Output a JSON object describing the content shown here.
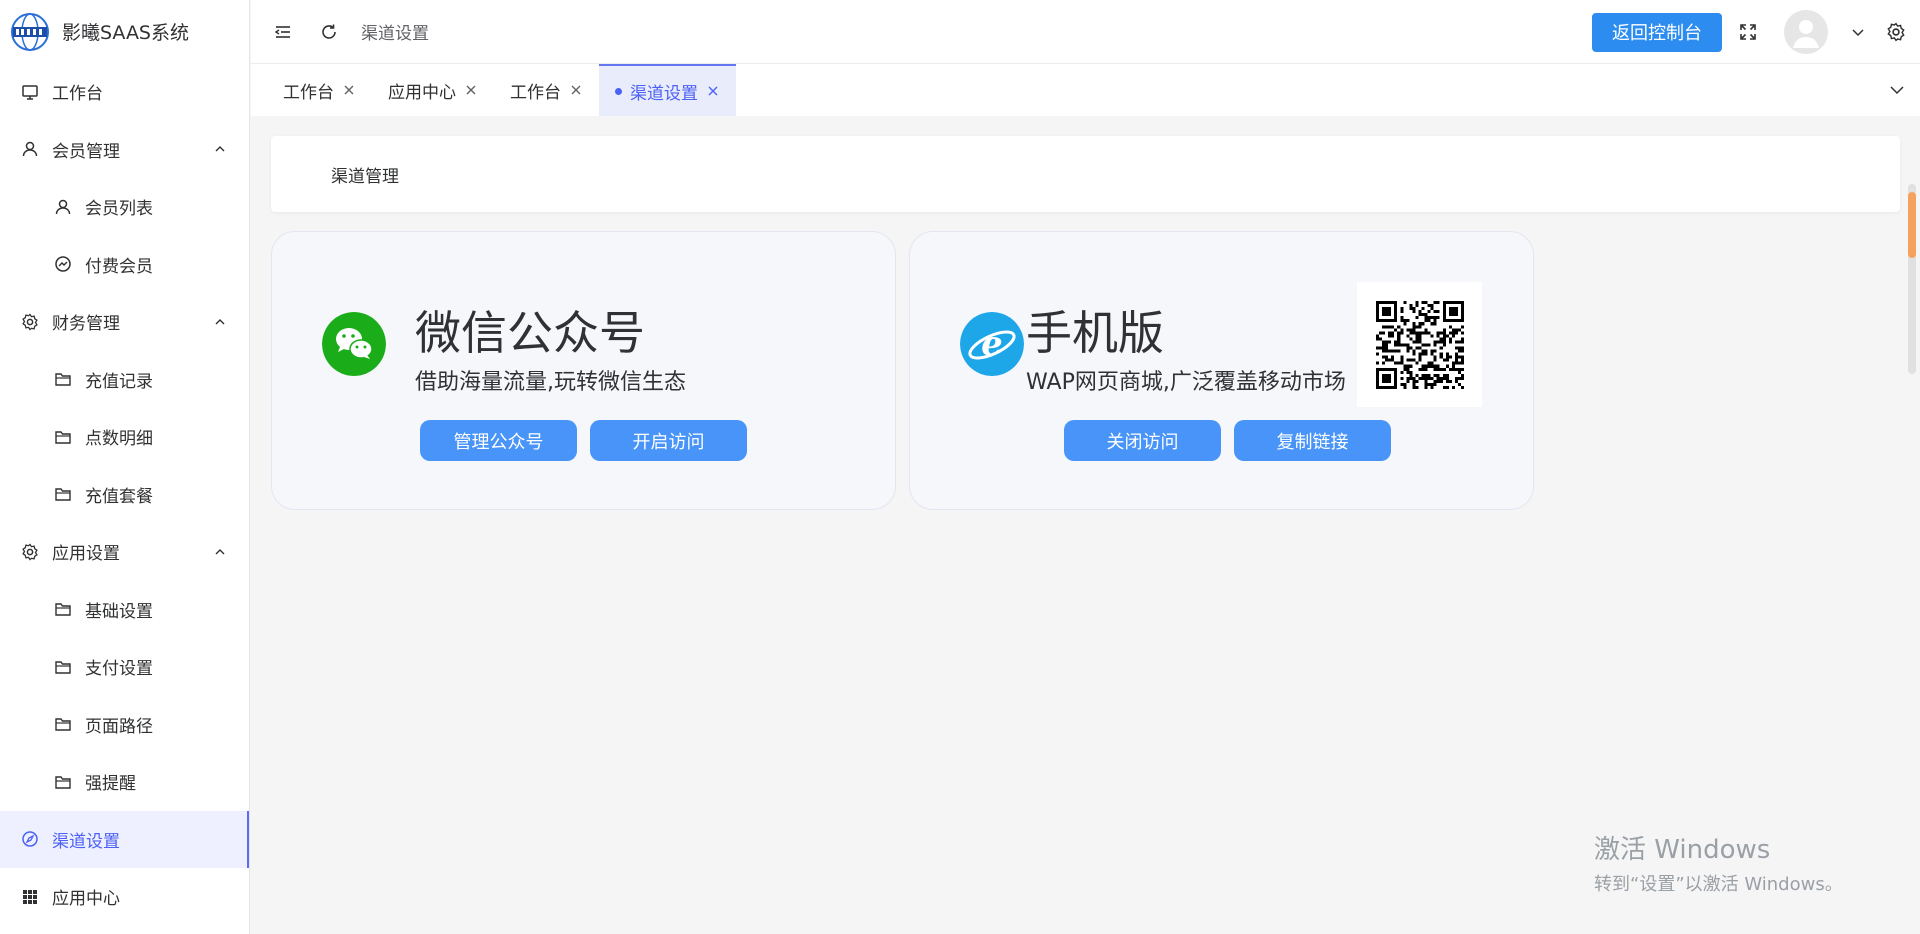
{
  "brand": {
    "name": "影曦SAAS系统"
  },
  "sidebar": {
    "items": [
      {
        "label": "工作台",
        "icon": "monitor-icon"
      },
      {
        "label": "会员管理",
        "icon": "user-icon"
      },
      {
        "label": "会员列表",
        "icon": "user-icon"
      },
      {
        "label": "付费会员",
        "icon": "gauge-icon"
      },
      {
        "label": "财务管理",
        "icon": "gear-icon"
      },
      {
        "label": "充值记录",
        "icon": "folder-icon"
      },
      {
        "label": "点数明细",
        "icon": "folder-icon"
      },
      {
        "label": "充值套餐",
        "icon": "folder-icon"
      },
      {
        "label": "应用设置",
        "icon": "gear-icon"
      },
      {
        "label": "基础设置",
        "icon": "folder-icon"
      },
      {
        "label": "支付设置",
        "icon": "folder-icon"
      },
      {
        "label": "页面路径",
        "icon": "folder-icon"
      },
      {
        "label": "强提醒",
        "icon": "folder-icon"
      },
      {
        "label": "渠道设置",
        "icon": "compass-icon"
      },
      {
        "label": "应用中心",
        "icon": "grid-icon"
      }
    ]
  },
  "header": {
    "breadcrumb": "渠道设置",
    "back_button": "返回控制台"
  },
  "tabs": [
    {
      "label": "工作台"
    },
    {
      "label": "应用中心"
    },
    {
      "label": "工作台"
    },
    {
      "label": "渠道设置"
    }
  ],
  "page": {
    "title": "渠道管理"
  },
  "channels": {
    "wechat": {
      "title": "微信公众号",
      "subtitle": "借助海量流量,玩转微信生态",
      "btn_manage": "管理公众号",
      "btn_toggle": "开启访问"
    },
    "mobile": {
      "title": "手机版",
      "subtitle": "WAP网页商城,广泛覆盖移动市场",
      "btn_toggle": "关闭访问",
      "btn_copy": "复制链接"
    }
  },
  "watermark": {
    "line1": "激活 Windows",
    "line2": "转到“设置”以激活 Windows。"
  },
  "colors": {
    "accent": "#4c61f5",
    "primary_button": "#2d8cf0",
    "channel_button": "#4894f8",
    "wechat_green": "#1aad19",
    "ie_blue": "#1ea7e8"
  }
}
